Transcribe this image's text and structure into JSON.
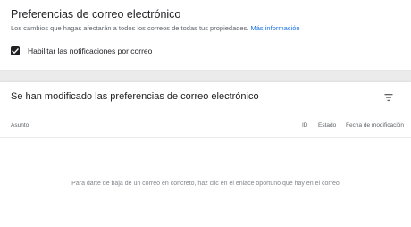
{
  "prefs": {
    "title": "Preferencias de correo electrónico",
    "subtitle": "Los cambios que hagas afectarán a todos los correos de todas tus propiedades.",
    "more_info": "Más información",
    "checkbox_label": "Habilitar las notificaciones por correo",
    "checkbox_checked": true
  },
  "changes": {
    "title": "Se han modificado las preferencias de correo electrónico",
    "filter_icon": "filter-icon",
    "columns": [
      "Asunto",
      "ID",
      "Estado",
      "Fecha de modificación"
    ],
    "empty_message": "Para darte de baja de un correo en concreto, haz clic en el enlace oportuno que hay en el correo"
  }
}
